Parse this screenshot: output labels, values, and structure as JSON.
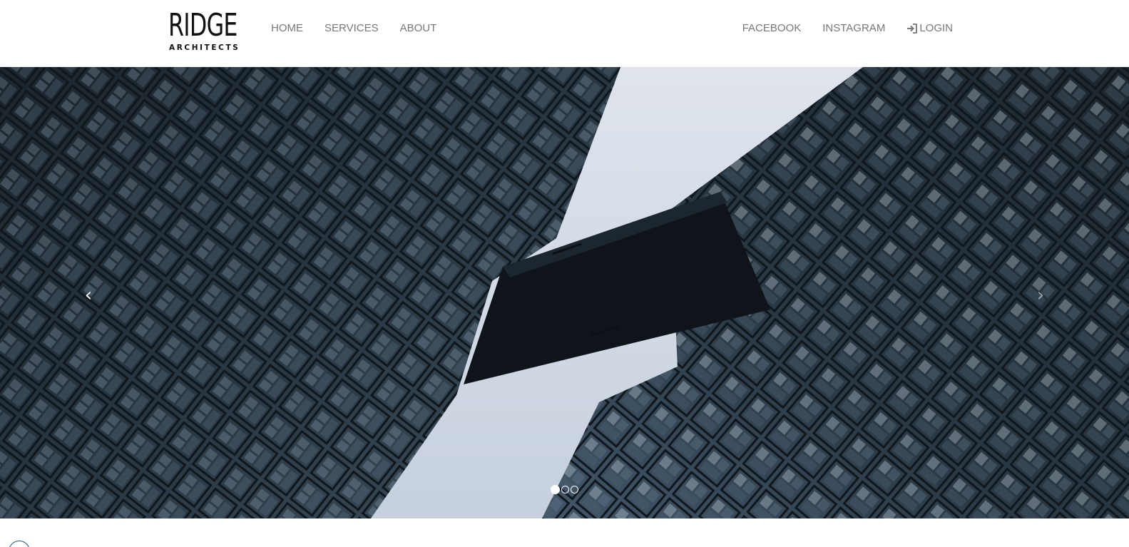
{
  "brand": {
    "name": "RIDGE",
    "tagline": "ARCHITECTS"
  },
  "nav": {
    "left": [
      {
        "label": "HOME"
      },
      {
        "label": "SERVICES"
      },
      {
        "label": "ABOUT"
      }
    ],
    "right": [
      {
        "label": "FACEBOOK"
      },
      {
        "label": "INSTAGRAM"
      },
      {
        "label": "LOGIN",
        "icon": "login-icon"
      }
    ]
  },
  "carousel": {
    "prev_label": "‹",
    "next_label": "›",
    "slide_count": 3,
    "active_slide": 1,
    "image_subject": "skybridge-between-glass-towers"
  },
  "colors": {
    "nav_text": "#777777",
    "logo": "#111111",
    "sky": "#c9d2de"
  }
}
